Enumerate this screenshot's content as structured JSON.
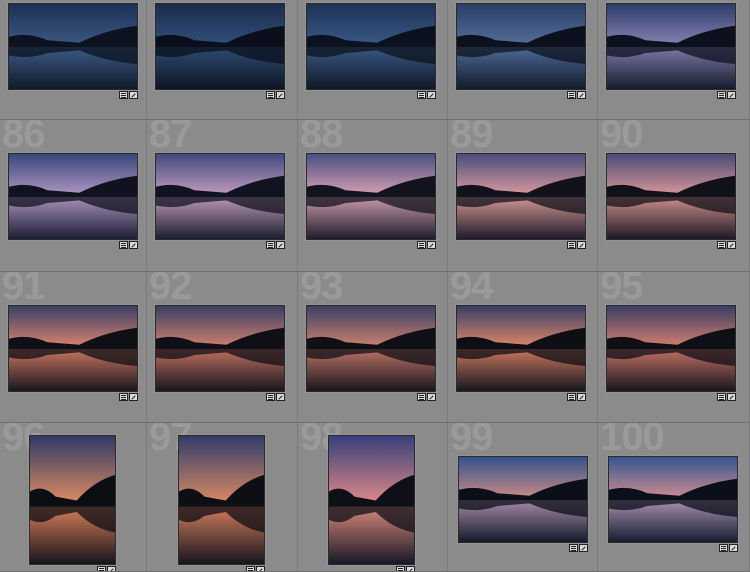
{
  "grid": {
    "index_labels": [
      "86",
      "87",
      "88",
      "89",
      "90",
      "91",
      "92",
      "93",
      "94",
      "95",
      "96",
      "97",
      "98",
      "99",
      "100"
    ],
    "badges": {
      "metadata_icon": "metadata-badge-icon",
      "edit_icon": "develop-adjusted-badge-icon"
    },
    "colors": {
      "background": "#8b8b8b",
      "cell_border": "#7a7a7a",
      "index_number": "#9a9a9a",
      "thumb_border": "#2a2a2a"
    }
  }
}
